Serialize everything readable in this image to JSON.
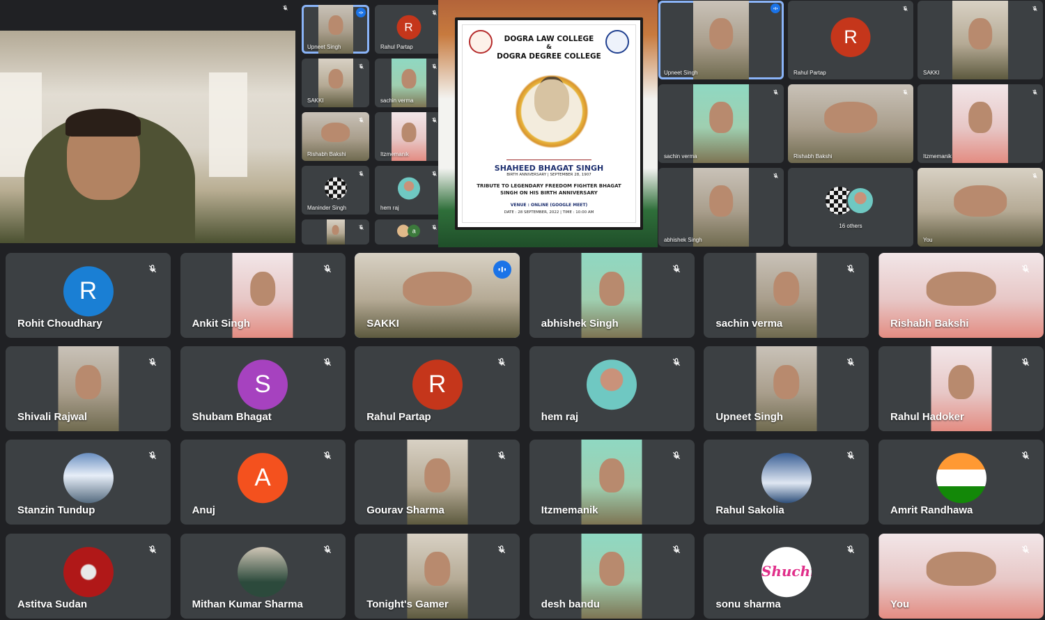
{
  "poster": {
    "college1": "DOGRA LAW COLLEGE",
    "amp": "&",
    "college2": "DOGRA DEGREE COLLEGE",
    "name": "SHAHEED BHAGAT SINGH",
    "anniv": "BIRTH ANNIVERSARY | SEPTEMBER 28, 1907",
    "tribute1": "TRIBUTE TO LEGENDARY FREEDOM FIGHTER BHAGAT",
    "tribute2": "SINGH ON HIS BIRTH ANNIVERSARY",
    "venue": "VENUE : ONLINE (GOOGLE MEET)",
    "date": "DATE : 28 SEPTEMBER, 2022 | TIME : 10:00 AM"
  },
  "share_mid": {
    "tiles": [
      {
        "name": "Upneet Singh",
        "kind": "cam",
        "speaking": true
      },
      {
        "name": "Rahul Partap",
        "kind": "avatar",
        "letter": "R",
        "color": "#c5361b"
      },
      {
        "name": "SAKKI",
        "kind": "cam"
      },
      {
        "name": "sachin verma",
        "kind": "cam"
      },
      {
        "name": "Rishabh Bakshi",
        "kind": "cam"
      },
      {
        "name": "Itzmemanik",
        "kind": "cam"
      },
      {
        "name": "Maninder Singh",
        "kind": "pic"
      },
      {
        "name": "hem raj",
        "kind": "pic"
      },
      {
        "name": "",
        "kind": "cam"
      },
      {
        "name": "a",
        "kind": "avatar"
      }
    ]
  },
  "share_right": {
    "tiles": [
      {
        "name": "Upneet Singh",
        "kind": "cam",
        "speaking": true
      },
      {
        "name": "Rahul Partap",
        "kind": "avatar",
        "letter": "R",
        "color": "#c5361b"
      },
      {
        "name": "SAKKI",
        "kind": "cam"
      },
      {
        "name": "sachin verma",
        "kind": "cam"
      },
      {
        "name": "Rishabh Bakshi",
        "kind": "cam"
      },
      {
        "name": "Itzmemanik",
        "kind": "cam"
      },
      {
        "name": "abhishek Singh",
        "kind": "cam"
      },
      {
        "name": "16 others",
        "kind": "others"
      },
      {
        "name": "You",
        "kind": "cam"
      }
    ]
  },
  "grid": {
    "tiles": [
      {
        "name": "Rohit Choudhary",
        "kind": "avatar",
        "letter": "R",
        "color": "#1a7fd4"
      },
      {
        "name": "Ankit Singh",
        "kind": "cam"
      },
      {
        "name": "SAKKI",
        "kind": "cam",
        "speaking": true
      },
      {
        "name": "abhishek Singh",
        "kind": "cam"
      },
      {
        "name": "sachin verma",
        "kind": "cam"
      },
      {
        "name": "Rishabh Bakshi",
        "kind": "cam"
      },
      {
        "name": "Shivali Rajwal",
        "kind": "cam"
      },
      {
        "name": "Shubam Bhagat",
        "kind": "avatar",
        "letter": "S",
        "color": "#a642bf"
      },
      {
        "name": "Rahul Partap",
        "kind": "avatar",
        "letter": "R",
        "color": "#c5361b"
      },
      {
        "name": "hem raj",
        "kind": "pic"
      },
      {
        "name": "Upneet Singh",
        "kind": "cam"
      },
      {
        "name": "Rahul Hadoker",
        "kind": "cam"
      },
      {
        "name": "Stanzin Tundup",
        "kind": "pic"
      },
      {
        "name": "Anuj",
        "kind": "avatar",
        "letter": "A",
        "color": "#f4511e"
      },
      {
        "name": "Gourav Sharma",
        "kind": "cam"
      },
      {
        "name": "Itzmemanik",
        "kind": "cam"
      },
      {
        "name": "Rahul Sakolia",
        "kind": "pic"
      },
      {
        "name": "Amrit Randhawa",
        "kind": "pic"
      },
      {
        "name": "Astitva Sudan",
        "kind": "pic"
      },
      {
        "name": "Mithan Kumar Sharma",
        "kind": "pic"
      },
      {
        "name": "Tonight's Gamer",
        "kind": "cam"
      },
      {
        "name": "desh bandu",
        "kind": "cam"
      },
      {
        "name": "sonu sharma",
        "kind": "pic",
        "text": "Shuchi"
      },
      {
        "name": "You",
        "kind": "cam"
      }
    ]
  },
  "colors": {
    "tile": "#3c4043",
    "background": "#202124",
    "speaking": "#8ab4f8"
  }
}
